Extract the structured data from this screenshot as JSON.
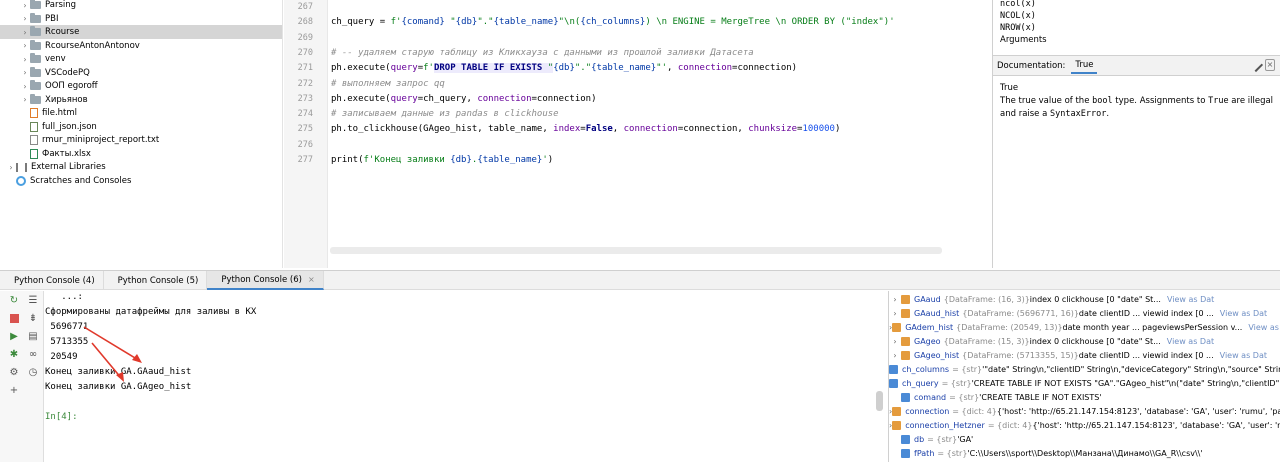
{
  "project_tree": [
    {
      "label": "Parsing",
      "type": "folder",
      "expandable": true
    },
    {
      "label": "PBI",
      "type": "folder",
      "expandable": true
    },
    {
      "label": "Rcourse",
      "type": "folder",
      "expandable": true,
      "selected": true
    },
    {
      "label": "RcourseAntonAntonov",
      "type": "folder",
      "expandable": true
    },
    {
      "label": "venv",
      "type": "folder",
      "expandable": true
    },
    {
      "label": "VSCodePQ",
      "type": "folder",
      "expandable": true
    },
    {
      "label": "ООП egoroff",
      "type": "folder",
      "expandable": true
    },
    {
      "label": "Хирьянов",
      "type": "folder",
      "expandable": true
    },
    {
      "label": "file.html",
      "type": "html"
    },
    {
      "label": "full_json.json",
      "type": "json"
    },
    {
      "label": "rmur_miniproject_report.txt",
      "type": "txt"
    },
    {
      "label": "Факты.xlsx",
      "type": "xlsx"
    },
    {
      "label": "External Libraries",
      "type": "lib",
      "expandable": true
    },
    {
      "label": "Scratches and Consoles",
      "type": "scratch"
    }
  ],
  "editor": {
    "line_numbers": [
      "267",
      "268",
      "269",
      "270",
      "271",
      "272",
      "273",
      "274",
      "275",
      "276",
      "277"
    ]
  },
  "doc_panel": {
    "functions": [
      "ncol(x)",
      "NCOL(x)",
      "NROW(x)"
    ],
    "arguments_label": "Arguments",
    "documentation_label": "Documentation:",
    "tab_label": "True",
    "title": "True",
    "body_1": "The true value of the ",
    "body_code_1": "bool",
    "body_2": " type. Assignments to ",
    "body_code_2": "True",
    "body_3": " are illegal and raise a ",
    "body_code_3": "SyntaxError",
    "body_4": "."
  },
  "console_tabs": [
    {
      "label": "Python Console (4)",
      "active": false
    },
    {
      "label": "Python Console (5)",
      "active": false
    },
    {
      "label": "Python Console (6)",
      "active": true
    }
  ],
  "console_lines": [
    "   ...:",
    "Сформированы датафреймы для заливы в КХ",
    " 5696771",
    " 5713355",
    " 20549",
    "Конец заливки GA.GAaud_hist",
    "Конец заливки GA.GAgeo_hist",
    "",
    "In[4]:"
  ],
  "variables": [
    {
      "name": "GAaud",
      "type": "{DataFrame: (16, 3)}",
      "value": "index        0              clickhouse [0               \"date\"  St...",
      "link": "View as Dat",
      "expandable": true
    },
    {
      "name": "GAaud_hist",
      "type": "{DataFrame: (5696771, 16)}",
      "value": "date          clientID  ...   viewid   index [0    ...",
      "link": "View as Dat",
      "expandable": true
    },
    {
      "name": "GAdem_hist",
      "type": "{DataFrame: (20549, 13)}",
      "value": "date  month  year  ...  pageviewsPerSession    v...",
      "link": "View as Dat",
      "expandable": true
    },
    {
      "name": "GAgeo",
      "type": "{DataFrame: (15, 3)}",
      "value": "index        0              clickhouse [0               \"date\"  St...",
      "link": "View as Dat",
      "expandable": true
    },
    {
      "name": "GAgeo_hist",
      "type": "{DataFrame: (5713355, 15)}",
      "value": "date          clientID  ...   viewid   index [0    ...",
      "link": "View as Dat",
      "expandable": true
    },
    {
      "name": "ch_columns",
      "type": "= {str}",
      "value": "'\"date\" String\\n,\"clientID\" String\\n,\"deviceCategory\" String\\n,\"source\" String\\n",
      "link": "",
      "expandable": false
    },
    {
      "name": "ch_query",
      "type": "= {str}",
      "value": "'CREATE TABLE IF NOT EXISTS \"GA\".\"GAgeo_hist\"\\n(\"date\" String\\n,\"clientID\" String",
      "link": "",
      "expandable": false
    },
    {
      "name": "comand",
      "type": "= {str}",
      "value": "'CREATE TABLE IF NOT EXISTS'",
      "link": "",
      "expandable": false
    },
    {
      "name": "connection",
      "type": "= {dict: 4}",
      "value": "{'host': 'http://65.21.147.154:8123', 'database': 'GA', 'user': 'rumu', 'password'",
      "link": "",
      "expandable": true
    },
    {
      "name": "connection_Hetzner",
      "type": "= {dict: 4}",
      "value": "{'host': 'http://65.21.147.154:8123', 'database': 'GA', 'user': 'rumu', 'pa",
      "link": "",
      "expandable": true
    },
    {
      "name": "db",
      "type": "= {str}",
      "value": "'GA'",
      "link": "",
      "expandable": false
    },
    {
      "name": "fPath",
      "type": "= {str}",
      "value": "'C:\\\\Users\\\\sport\\\\Desktop\\\\Манзана\\\\Динамо\\\\GA_R\\\\csv\\\\'",
      "link": "",
      "expandable": false
    }
  ]
}
